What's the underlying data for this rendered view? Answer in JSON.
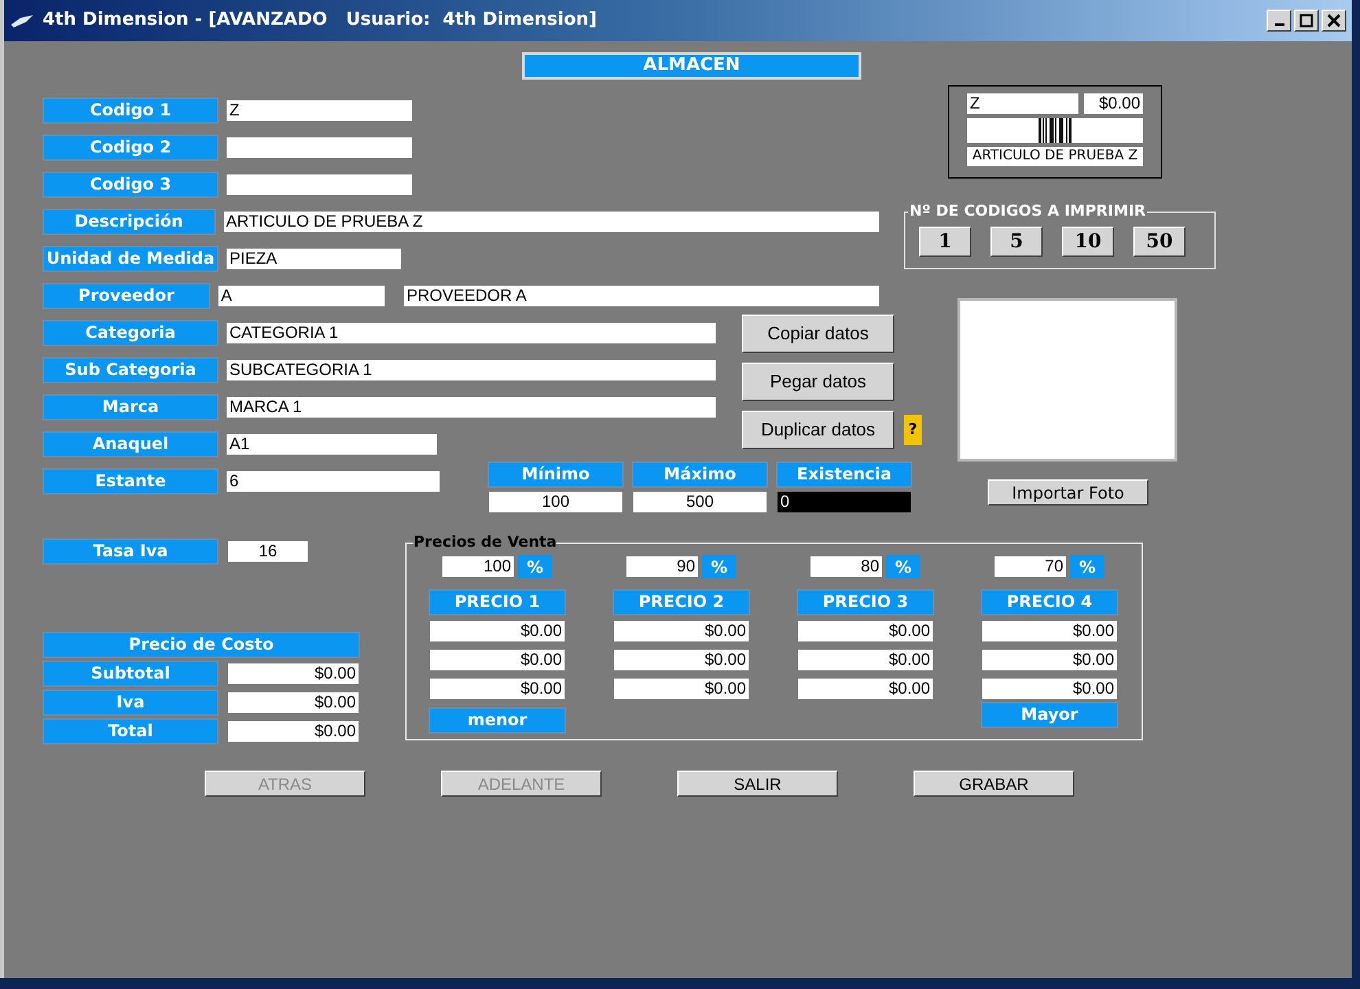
{
  "window": {
    "title": "4th Dimension - [AVANZADO   Usuario:  4th Dimension]"
  },
  "header": "ALMACEN",
  "fields": [
    {
      "label": "Codigo 1",
      "value": "Z"
    },
    {
      "label": "Codigo 2"
    },
    {
      "label": "Codigo 3"
    },
    {
      "label": "Descripción",
      "value": "ARTICULO DE PRUEBA Z"
    },
    {
      "label": "Unidad de Medida",
      "value": "PIEZA"
    },
    {
      "label": "Proveedor",
      "value": "A",
      "value_2": "PROVEEDOR A"
    },
    {
      "label": "Categoria",
      "value": "CATEGORIA 1"
    },
    {
      "label": "Sub Categoria",
      "value": "SUBCATEGORIA 1"
    },
    {
      "label": "Marca",
      "value": "MARCA 1"
    },
    {
      "label": "Anaquel",
      "value": "A1"
    },
    {
      "label": "Estante",
      "value": "6"
    }
  ],
  "data_buttons": [
    "Copiar datos",
    "Pegar datos",
    "Duplicar datos"
  ],
  "help_button": "?",
  "stock": [
    {
      "label": "Mínimo",
      "value": "100",
      "kind": "normal"
    },
    {
      "label": "Máximo",
      "value": "500",
      "kind": "normal"
    },
    {
      "label": "Existencia",
      "value": "0",
      "kind": "dark"
    }
  ],
  "barcode": {
    "code": "Z",
    "price": "$0.00",
    "description": "ARTICULO DE PRUEBA Z"
  },
  "print_codes": {
    "title": "Nº DE CODIGOS A IMPRIMIR",
    "buttons": [
      "1",
      "5",
      "10",
      "50"
    ]
  },
  "photo_button": "Importar Foto",
  "tasa_iva": {
    "label": "Tasa Iva",
    "value": "16"
  },
  "cost": {
    "title": "Precio de Costo",
    "rows": [
      {
        "label": "Subtotal",
        "value": "$0.00"
      },
      {
        "label": "Iva",
        "value": "$0.00"
      },
      {
        "label": "Total",
        "value": "$0.00"
      }
    ]
  },
  "sale_prices": {
    "title": "Precios de Venta",
    "columns": [
      {
        "percent": "100",
        "percent_button": "%",
        "header": "PRECIO 1",
        "values": [
          "$0.00",
          "$0.00",
          "$0.00"
        ],
        "footer": "menor"
      },
      {
        "percent": "90",
        "percent_button": "%",
        "header": "PRECIO 2",
        "values": [
          "$0.00",
          "$0.00",
          "$0.00"
        ]
      },
      {
        "percent": "80",
        "percent_button": "%",
        "header": "PRECIO 3",
        "values": [
          "$0.00",
          "$0.00",
          "$0.00"
        ]
      },
      {
        "percent": "70",
        "percent_button": "%",
        "header": "PRECIO 4",
        "values": [
          "$0.00",
          "$0.00",
          "$0.00"
        ],
        "footer": "Mayor"
      }
    ]
  },
  "bottom_buttons": [
    {
      "label": "ATRAS",
      "disabled": true
    },
    {
      "label": "ADELANTE",
      "disabled": true
    },
    {
      "label": "SALIR",
      "disabled": false
    },
    {
      "label": "GRABAR",
      "disabled": false
    }
  ]
}
